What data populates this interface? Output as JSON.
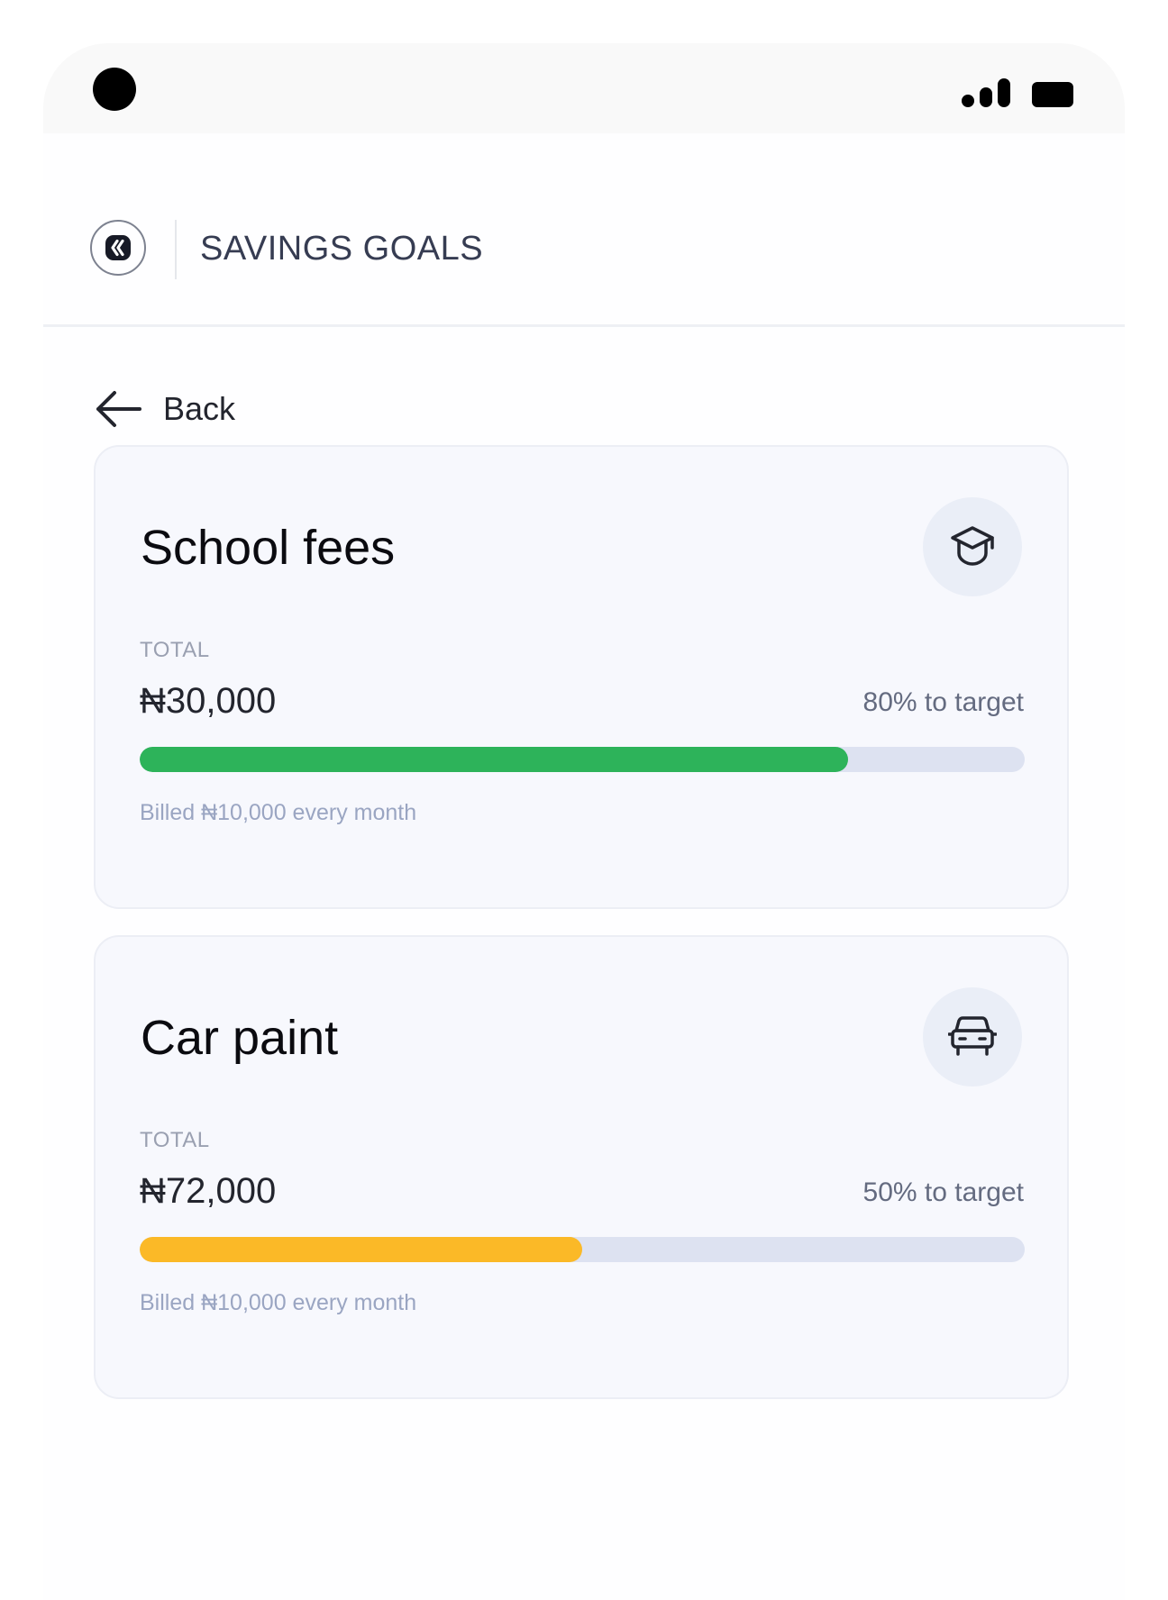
{
  "header": {
    "title": "SAVINGS GOALS",
    "logo_icon": "k-brand-logo-icon"
  },
  "nav": {
    "back_label": "Back",
    "back_icon": "arrow-left-icon"
  },
  "colors": {
    "card_background": "#f7f8fd",
    "track": "#dde2f1",
    "green": "#2db35a",
    "yellow": "#fbb927"
  },
  "goals": [
    {
      "title": "School fees",
      "icon": "graduation-cap-icon",
      "total_label": "TOTAL",
      "total_amount": "₦30,000",
      "target_text": "80% to target",
      "progress_percent": 80,
      "progress_color": "#2db35a",
      "billed_text": "Billed ₦10,000 every month"
    },
    {
      "title": "Car paint",
      "icon": "car-icon",
      "total_label": "TOTAL",
      "total_amount": "₦72,000",
      "target_text": "50% to target",
      "progress_percent": 50,
      "progress_color": "#fbb927",
      "billed_text": "Billed ₦10,000 every month"
    }
  ]
}
